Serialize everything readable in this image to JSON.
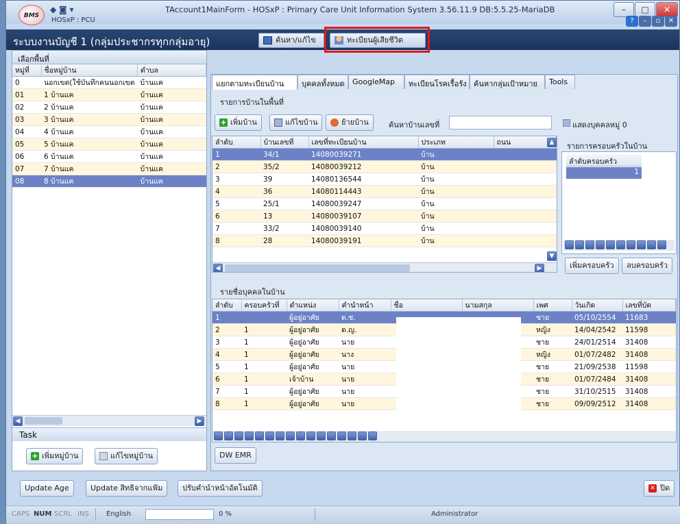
{
  "window": {
    "title": "TAccount1MainForm - HOSxP : Primary Care Unit Information System 3.56.11.9 DB:5.5.25-MariaDB",
    "app_name": "HOSxP : PCU",
    "logo_text": "BMS"
  },
  "header": {
    "title": "ระบบงานบัญชี 1 (กลุ่มประชากรทุกกลุ่มอายุ)",
    "search_edit_label": "ค้นหา/แก้ไข",
    "death_registry_label": "ทะเบียนผู้เสียชีวิต"
  },
  "left": {
    "heading": "เลือกพื้นที่",
    "columns": [
      "หมู่ที่",
      "ชื่อหมู่บ้าน",
      "ตำบล"
    ],
    "rows": [
      [
        "0",
        "นอกเขต(ใช้บันทึกคนนอกเขต",
        "บ้านแค"
      ],
      [
        "01",
        "1 บ้านแค",
        "บ้านแค"
      ],
      [
        "02",
        "2 บ้านแค",
        "บ้านแค"
      ],
      [
        "03",
        "3 บ้านแค",
        "บ้านแค"
      ],
      [
        "04",
        "4 บ้านแค",
        "บ้านแค"
      ],
      [
        "05",
        "5 บ้านแค",
        "บ้านแค"
      ],
      [
        "06",
        "6 บ้านแค",
        "บ้านแค"
      ],
      [
        "07",
        "7 บ้านแค",
        "บ้านแค"
      ],
      [
        "08",
        "8 บ้านแค",
        "บ้านแค"
      ]
    ],
    "task_label": "Task",
    "add_village": "เพิ่มหมู่บ้าน",
    "edit_village": "แก้ไขหมู่บ้าน"
  },
  "tabs": [
    "แยกตามทะเบียนบ้าน",
    "บุคคลทั้งหมด",
    "GoogleMap",
    "ทะเบียนโรคเรื้อรัง",
    "ค้นหากลุ่มเป้าหมาย",
    "Tools"
  ],
  "houses": {
    "heading": "รายการบ้านในพื้นที่",
    "add_house": "เพิ่มบ้าน",
    "edit_house": "แก้ไขบ้าน",
    "move_house": "ย้ายบ้าน",
    "search_label": "ค้นหาบ้านเลขที่",
    "search_value": "",
    "show_moo0_label": "แสดงบุคคลหมู่ 0",
    "columns": [
      "ลำดับ",
      "บ้านเลขที่",
      "เลขที่ทะเบียนบ้าน",
      "ประเภท",
      "ถนน"
    ],
    "rows": [
      [
        "1",
        "34/1",
        "14080039271",
        "บ้าน",
        ""
      ],
      [
        "2",
        "35/2",
        "14080039212",
        "บ้าน",
        ""
      ],
      [
        "3",
        "39",
        "14080136544",
        "บ้าน",
        ""
      ],
      [
        "4",
        "36",
        "14080114443",
        "บ้าน",
        ""
      ],
      [
        "5",
        "25/1",
        "14080039247",
        "บ้าน",
        ""
      ],
      [
        "6",
        "13",
        "14080039107",
        "บ้าน",
        ""
      ],
      [
        "7",
        "33/2",
        "14080039140",
        "บ้าน",
        ""
      ],
      [
        "8",
        "28",
        "14080039191",
        "บ้าน",
        ""
      ]
    ],
    "family_heading": "รายการครอบครัวในบ้าน",
    "family_column": "ลำดับครอบครัว",
    "family_value": "1",
    "add_family": "เพิ่มครอบครัว",
    "del_family": "ลบครอบครัว"
  },
  "people": {
    "heading": "รายชื่อบุคคลในบ้าน",
    "columns": [
      "ลำดับ",
      "ครอบครัวที่",
      "ตำแหน่ง",
      "คำนำหน้า",
      "ชื่อ",
      "นามสกุล",
      "เพศ",
      "วันเกิด",
      "เลขที่บัต"
    ],
    "rows": [
      [
        "1",
        "",
        "ผู้อยู่อาศัย",
        "ด.ช.",
        "",
        "",
        "ชาย",
        "05/10/2554",
        "11683"
      ],
      [
        "2",
        "1",
        "ผู้อยู่อาศัย",
        "ด.ญ.",
        "",
        "",
        "หญิง",
        "14/04/2542",
        "11598"
      ],
      [
        "3",
        "1",
        "ผู้อยู่อาศัย",
        "นาย",
        "",
        "",
        "ชาย",
        "24/01/2514",
        "31408"
      ],
      [
        "4",
        "1",
        "ผู้อยู่อาศัย",
        "นาง",
        "",
        "",
        "หญิง",
        "01/07/2482",
        "31408"
      ],
      [
        "5",
        "1",
        "ผู้อยู่อาศัย",
        "นาย",
        "",
        "",
        "ชาย",
        "21/09/2538",
        "11598"
      ],
      [
        "6",
        "1",
        "เจ้าบ้าน",
        "นาย",
        "",
        "",
        "ชาย",
        "01/07/2484",
        "31408"
      ],
      [
        "7",
        "1",
        "ผู้อยู่อาศัย",
        "นาย",
        "",
        "",
        "ชาย",
        "31/10/2515",
        "31408"
      ],
      [
        "8",
        "1",
        "ผู้อยู่อาศัย",
        "นาย",
        "",
        "",
        "ชาย",
        "09/09/2512",
        "31408"
      ]
    ],
    "dwemr": "DW EMR"
  },
  "bottom": {
    "update_age": "Update Age",
    "update_rights": "Update สิทธิจากแฟ้ม",
    "auto_prefix": "ปรับคำนำหน้าอัตโนมัติ",
    "close": "ปิด"
  },
  "status": {
    "caps": "CAPS",
    "num": "NUM",
    "scrl": "SCRL",
    "ins": "INS",
    "lang": "English",
    "percent": "0 %",
    "user": "Administrator"
  }
}
